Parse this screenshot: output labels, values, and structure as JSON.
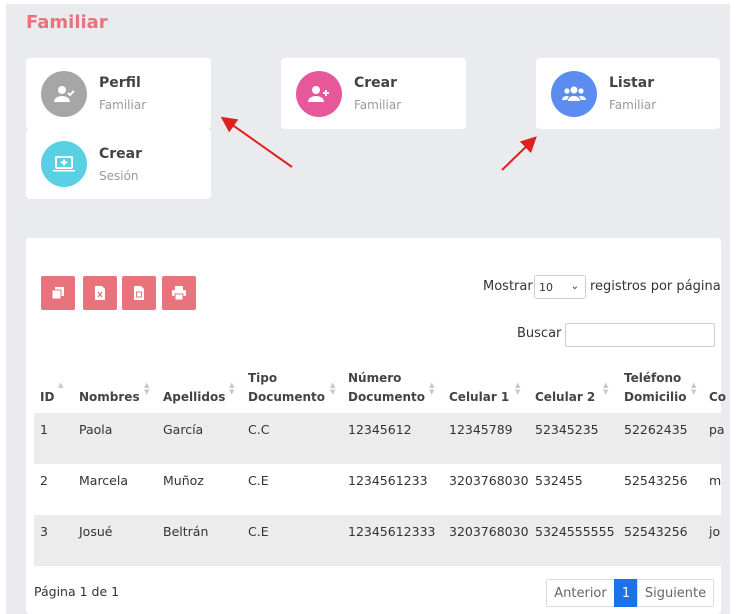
{
  "page": {
    "title": "Familiar"
  },
  "cards": [
    {
      "title": "Perfil",
      "subtitle": "Familiar",
      "icon": "user-check-icon",
      "color": "#a6a6a6"
    },
    {
      "title": "Crear",
      "subtitle": "Familiar",
      "icon": "user-plus-icon",
      "color": "#e7589a"
    },
    {
      "title": "Listar",
      "subtitle": "Familiar",
      "icon": "users-icon",
      "color": "#5b8cf0"
    },
    {
      "title": "Crear",
      "subtitle": "Sesión",
      "icon": "laptop-plus-icon",
      "color": "#5ad0e4"
    }
  ],
  "toolbar": {
    "buttons": [
      "copy-icon",
      "excel-icon",
      "csv-icon",
      "print-icon"
    ],
    "button_color": "#e8737c"
  },
  "length": {
    "prefix": "Mostrar",
    "value": "10",
    "suffix": "registros por página"
  },
  "search": {
    "label": "Buscar",
    "value": ""
  },
  "table": {
    "columns": [
      {
        "line1": "",
        "line2": "ID"
      },
      {
        "line1": "",
        "line2": "Nombres"
      },
      {
        "line1": "",
        "line2": "Apellidos"
      },
      {
        "line1": "Tipo",
        "line2": "Documento"
      },
      {
        "line1": "Número",
        "line2": "Documento"
      },
      {
        "line1": "",
        "line2": "Celular 1"
      },
      {
        "line1": "",
        "line2": "Celular 2"
      },
      {
        "line1": "Teléfono",
        "line2": "Domicilio"
      },
      {
        "line1": "",
        "line2": "Co"
      }
    ],
    "rows": [
      [
        "1",
        "Paola",
        "García",
        "C.C",
        "12345612",
        "12345789",
        "52345235",
        "52262435",
        "pa"
      ],
      [
        "2",
        "Marcela",
        "Muñoz",
        "C.E",
        "1234561233",
        "3203768030",
        "532455",
        "52543256",
        "m"
      ],
      [
        "3",
        "Josué",
        "Beltrán",
        "C.E",
        "12345612333",
        "3203768030",
        "5324555555",
        "52543256",
        "jo"
      ]
    ]
  },
  "pagination": {
    "info": "Página 1 de 1",
    "prev": "Anterior",
    "current": "1",
    "next": "Siguiente",
    "active_color": "#1a73e8"
  },
  "colors": {
    "accent": "#e8737c",
    "arrow": "#e02020"
  }
}
